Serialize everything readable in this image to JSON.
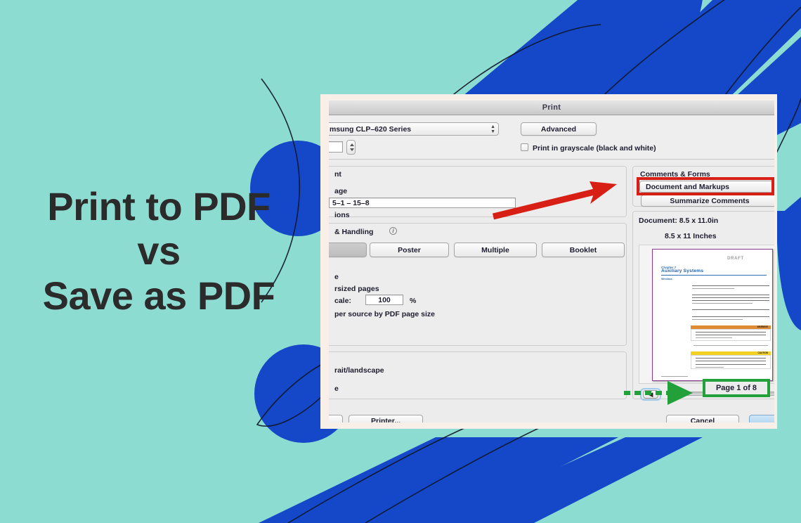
{
  "headline": {
    "text": "Print to PDF\nvs\nSave as PDF",
    "color": "#2b2b2b"
  },
  "theme": {
    "background": "#8ddcd2",
    "accent_blue": "#1448c8",
    "frame_cream": "#f9efe9",
    "annotation_red": "#d81f16",
    "annotation_green": "#22a13a"
  },
  "dialog": {
    "title": "Print",
    "printer_popup": "msung CLP–620 Series",
    "advanced_button": "Advanced",
    "grayscale_checkbox_label": "Print in grayscale (black and white)",
    "copies_value": "",
    "pages_group": {
      "header": "nt",
      "page_label": "age",
      "range_value": "5–1 – 15–8",
      "options_label": "ions"
    },
    "sizing_group": {
      "header": "& Handling",
      "info_icon": "info-icon",
      "buttons": [
        "",
        "Poster",
        "Multiple",
        "Booklet"
      ],
      "selected_button_index": 0,
      "size_label": "e",
      "oversized_label": "rsized pages",
      "scale_label": "cale:",
      "scale_value": "100",
      "scale_unit": "%",
      "paper_source_label": "per source by PDF page size"
    },
    "orientation_group": {
      "auto_label": "rait/landscape",
      "second_label": "e"
    },
    "comments_panel": {
      "header": "Comments & Forms",
      "popup_value": "Document and Markups",
      "summarize_button": "Summarize Comments"
    },
    "preview": {
      "document_size": "Document: 8.5 x 11.0in",
      "paper_size": "8.5 x 11 Inches",
      "page_indicator": "Page 1 of 8",
      "back_button": "◀",
      "doc_watermark": "DRAFT",
      "doc_kicker": "Chapter 7",
      "doc_title": "Auxiliary Systems",
      "doc_section": "Windlass",
      "doc_warning_tag": "WARNING",
      "doc_caution_tag": "CAUTION",
      "doc_footer": "Auxiliary Systems"
    },
    "footer": {
      "printer_button": "Printer...",
      "cancel_button": "Cancel",
      "clipped_left_button": "",
      "default_button": ""
    }
  },
  "annotations": {
    "red_arrow": "red-arrow-pointing-to-summarize-comments",
    "red_highlight_target": "Summarize Comments",
    "green_arrow": "green-dashed-arrow-pointing-to-page-indicator",
    "green_highlight_target": "Page 1 of 8"
  }
}
